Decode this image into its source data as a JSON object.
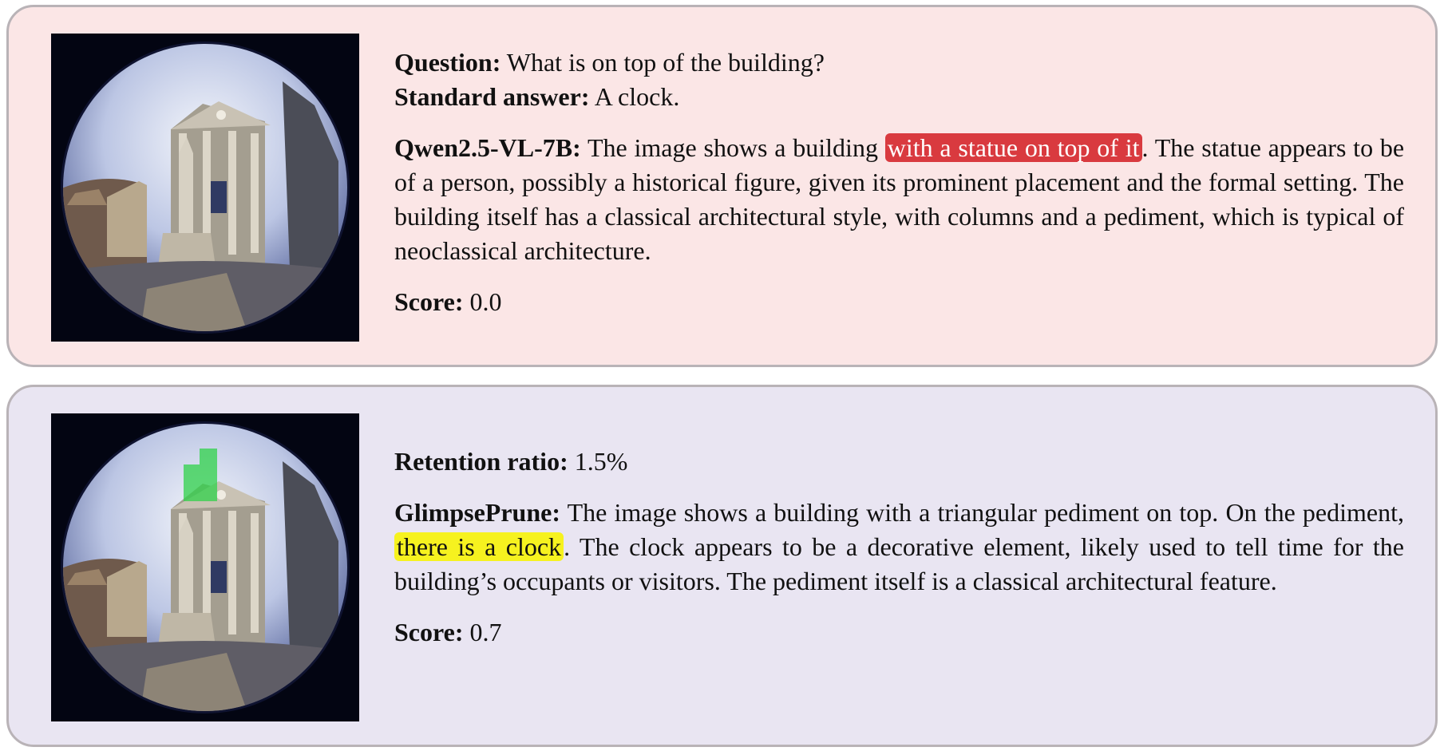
{
  "top": {
    "question_label": "Question:",
    "question_text": "What is on top of the building?",
    "answer_label": "Standard answer:",
    "answer_text": "A clock.",
    "model_label": "Qwen2.5-VL-7B:",
    "response_before": "The image shows a building",
    "response_highlight": "with a statue on top of it",
    "response_after": ". The statue appears to be of a person, possibly a historical figure, given its prominent placement and the formal setting. The building itself has a classical architectural style, with columns and a pediment, which is typical of neoclassical architecture.",
    "score_label": "Score:",
    "score_value": "0.0"
  },
  "bottom": {
    "ratio_label": "Retention ratio:",
    "ratio_value": "1.5%",
    "model_label": "GlimpsePrune:",
    "response_before": "The image shows a building with a triangular pediment on top. On the pediment,",
    "response_highlight": "there is a clock",
    "response_after": ". The clock appears to be a decorative element, likely used to tell time for the building’s occupants or visitors. The pediment itself is a classical architectural feature.",
    "score_label": "Score:",
    "score_value": "0.7"
  },
  "colors": {
    "top_panel_bg": "#fbe6e6",
    "bottom_panel_bg": "#e9e5f2",
    "highlight_red": "#d93a3f",
    "highlight_yellow": "#f6f21f",
    "retained_token_green": "#2fd14a"
  }
}
